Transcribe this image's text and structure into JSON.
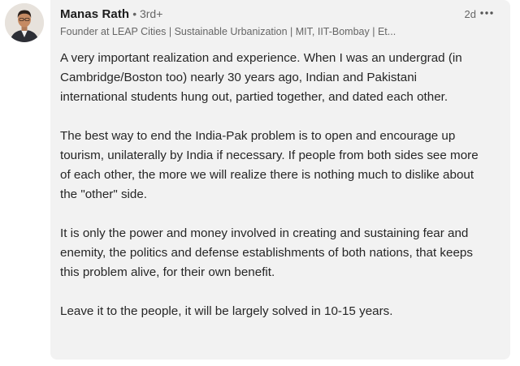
{
  "comment": {
    "author": {
      "name": "Manas Rath",
      "degree": "• 3rd+",
      "headline": "Founder at LEAP Cities | Sustainable Urbanization | MIT, IIT-Bombay | Et..."
    },
    "timestamp": "2d",
    "more_icon": "ellipsis-icon",
    "avatar_icon": "profile-photo",
    "paragraphs": [
      "A very important realization and experience. When I was an undergrad (in Cambridge/Boston too) nearly 30 years ago, Indian and Pakistani international students hung out, partied together, and dated each other.",
      "The best way to end the India-Pak problem is to open and encourage up tourism, unilaterally by India if necessary. If people from both sides see more of each other, the more we will realize there is nothing much to dislike about the \"other\" side.",
      "It is only the power and money involved in creating and sustaining fear and enemity, the politics and defense establishments of both nations, that keeps this problem alive, for their own benefit.",
      "Leave it to the people, it will be largely solved in 10-15 years."
    ]
  }
}
